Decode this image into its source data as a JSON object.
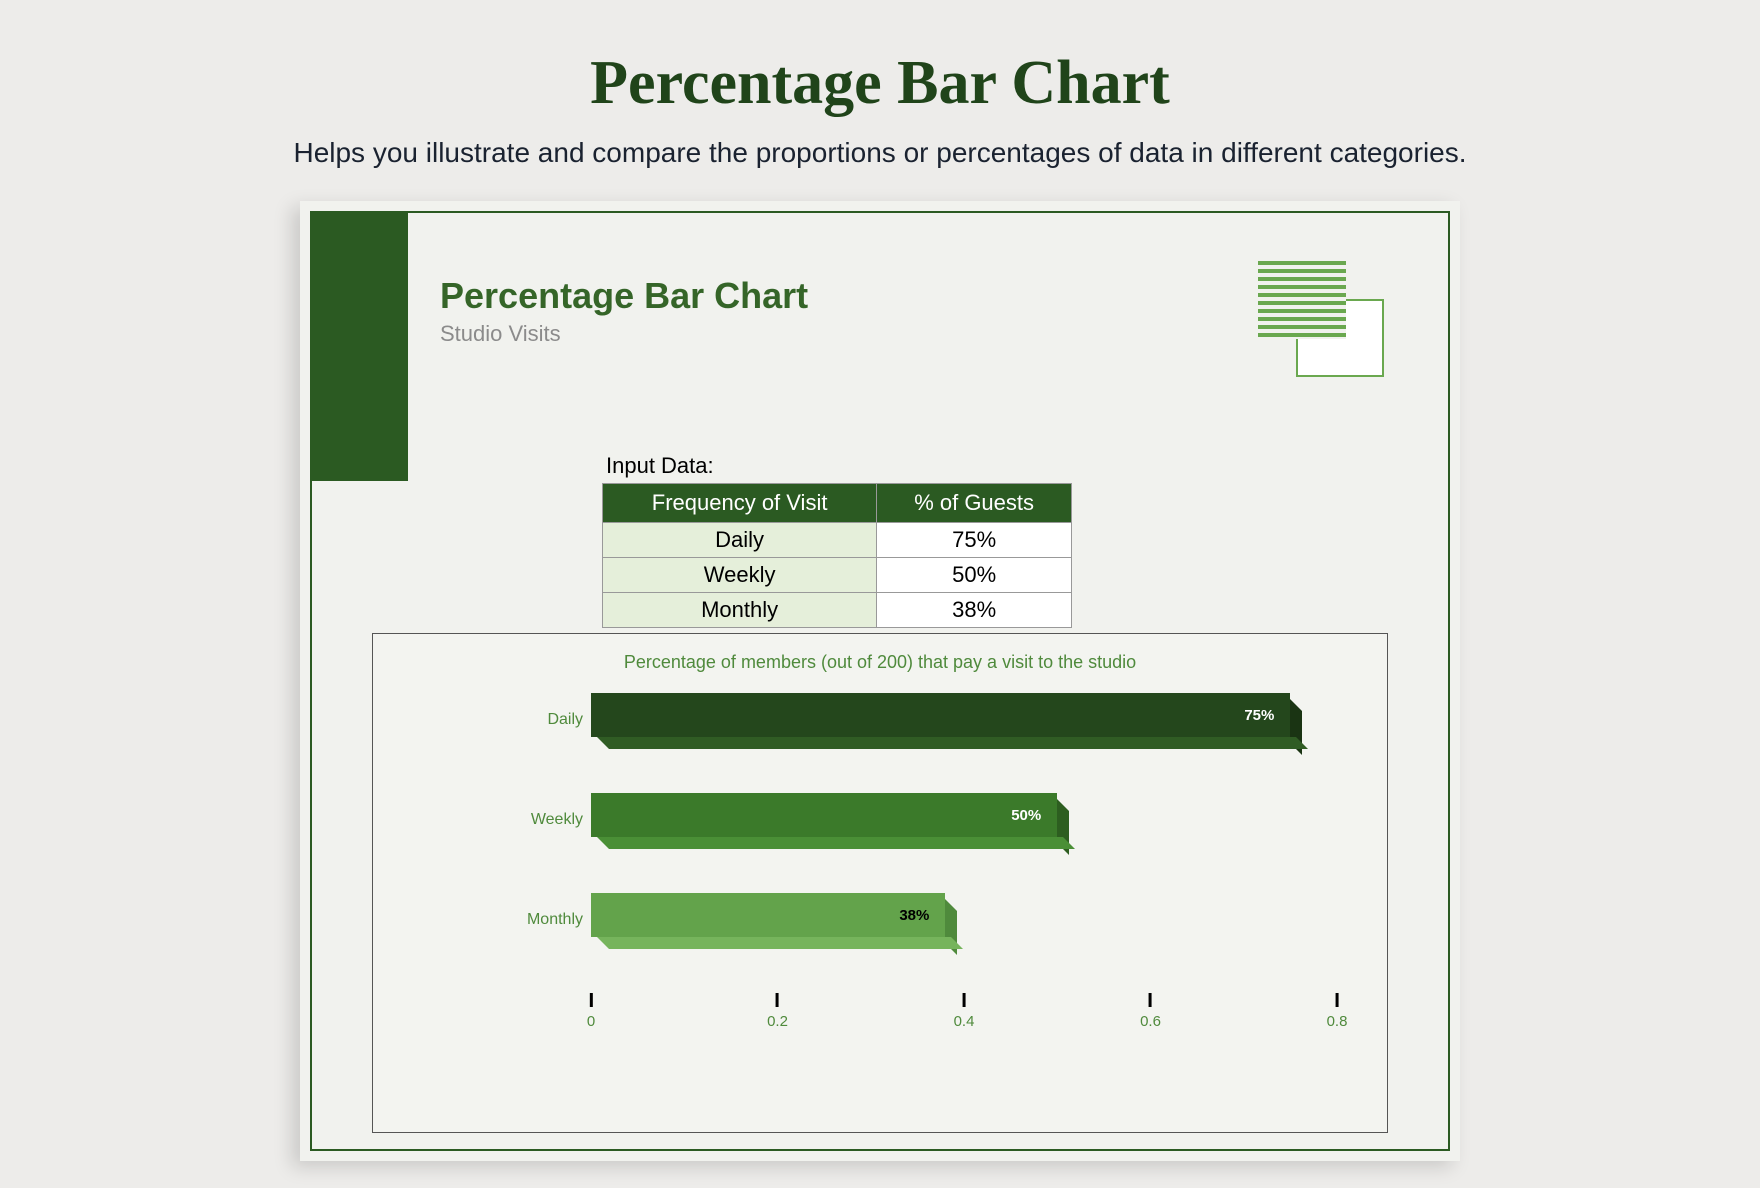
{
  "page": {
    "title": "Percentage Bar Chart",
    "subtitle": "Helps you illustrate and compare the proportions or percentages of data in different categories."
  },
  "document": {
    "title": "Percentage Bar Chart",
    "subtitle": "Studio Visits",
    "input_label": "Input Data:",
    "table": {
      "headers": {
        "freq": "Frequency of Visit",
        "pct": "% of Guests"
      },
      "rows": [
        {
          "freq": "Daily",
          "pct": "75%"
        },
        {
          "freq": "Weekly",
          "pct": "50%"
        },
        {
          "freq": "Monthly",
          "pct": "38%"
        }
      ]
    }
  },
  "chart_data": {
    "type": "bar",
    "orientation": "horizontal",
    "title": "Percentage of members (out of 200) that pay a visit to the studio",
    "categories": [
      "Daily",
      "Weekly",
      "Monthly"
    ],
    "values": [
      0.75,
      0.5,
      0.38
    ],
    "value_labels": [
      "75%",
      "50%",
      "38%"
    ],
    "xlim": [
      0,
      0.8
    ],
    "xticks": [
      0,
      0.2,
      0.4,
      0.6,
      0.8
    ],
    "xtick_labels": [
      "0",
      "0.2",
      "0.4",
      "0.6",
      "0.8"
    ],
    "xlabel": "",
    "ylabel": ""
  }
}
